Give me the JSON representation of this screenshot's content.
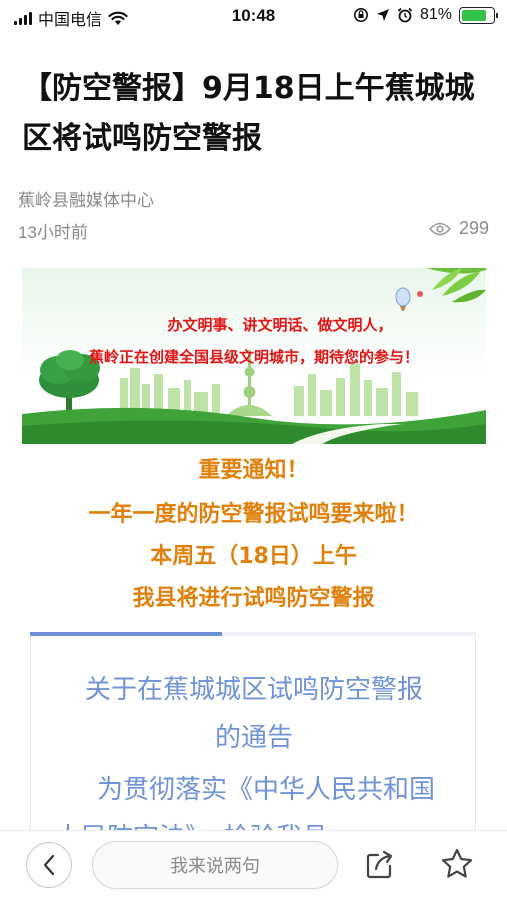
{
  "status_bar": {
    "carrier": "中国电信",
    "time": "10:48",
    "battery": "81%",
    "battery_level": 0.81
  },
  "article": {
    "title": "【防空警报】9月18日上午蕉城城区将试鸣防空警报",
    "source": "蕉岭县融媒体中心",
    "time": "13小时前",
    "views": "299"
  },
  "banner": {
    "line1": "办文明事、讲文明话、做文明人，",
    "line2": "蕉岭正在创建全国县级文明城市，期待您的参与！"
  },
  "notice": {
    "lines": [
      "重要通知！",
      "一年一度的防空警报试鸣要来啦！",
      "本周五（18日）上午",
      "我县将进行试鸣防空警报"
    ]
  },
  "card": {
    "progress": 0.43,
    "title_line1": "关于在蕉城城区试鸣防空警报",
    "title_line2": "的通告",
    "body": "为贯彻落实《中华人民共和国人民防空法》，检验我县"
  },
  "bottom_bar": {
    "comment_placeholder": "我来说两句"
  },
  "colors": {
    "notice": "#e0800a",
    "card_text": "#6f93d6",
    "banner_text": "#e01414",
    "battery": "#35c24a"
  }
}
